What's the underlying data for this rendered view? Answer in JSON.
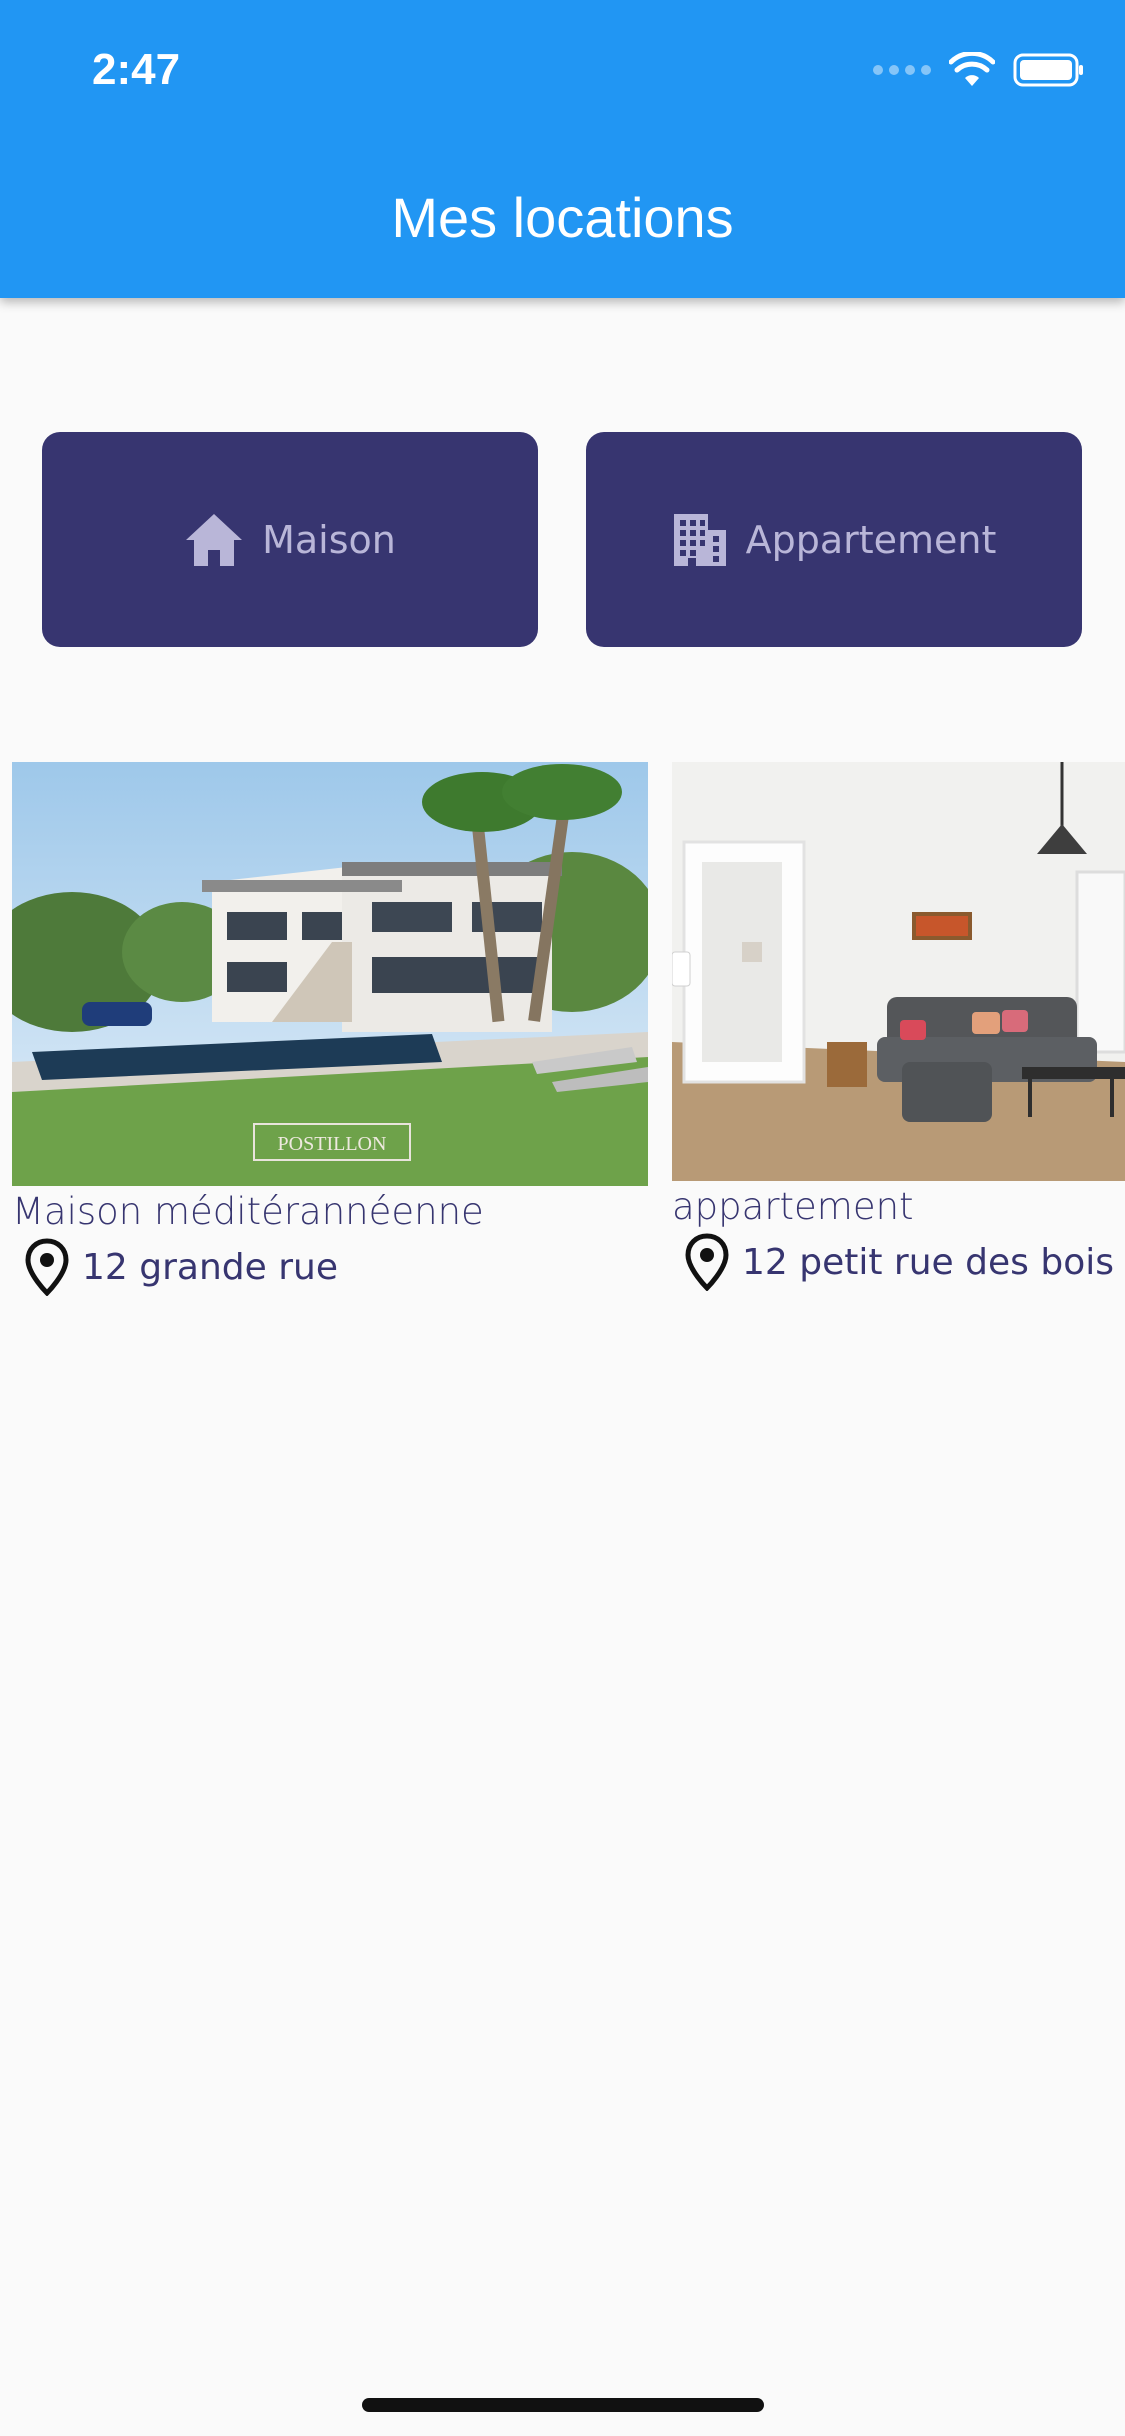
{
  "status_bar": {
    "time": "2:47"
  },
  "app_bar": {
    "title": "Mes locations"
  },
  "filters": [
    {
      "label": "Maison",
      "icon": "house-icon"
    },
    {
      "label": "Appartement",
      "icon": "building-icon"
    }
  ],
  "listings": [
    {
      "title": "Maison méditérannéenne",
      "address": "12 grande rue",
      "photo_watermark": "POSTILLON"
    },
    {
      "title": "appartement",
      "address": "12 petit rue des bois"
    }
  ],
  "colors": {
    "app_bar": "#2196f3",
    "button": "#373570",
    "button_text": "#b9b6d8",
    "background": "#fafafa"
  }
}
